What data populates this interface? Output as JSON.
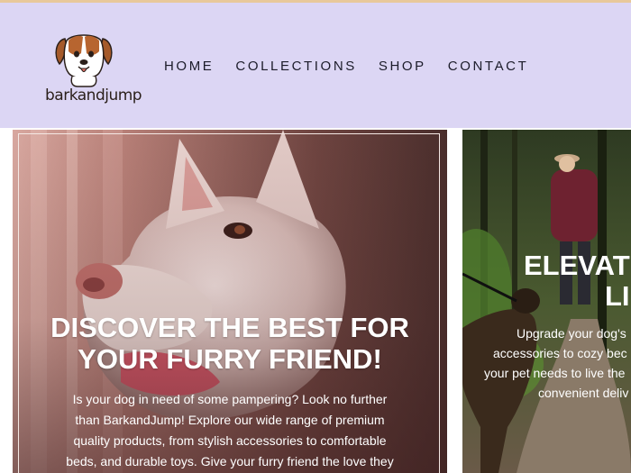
{
  "header": {
    "logo_text_bold": "bark",
    "logo_text_light": "andjump",
    "nav": [
      "HOME",
      "COLLECTIONS",
      "SHOP",
      "CONTACT"
    ]
  },
  "hero": {
    "heading_line1": "DISCOVER THE BEST FOR",
    "heading_line2": "YOUR FURRY FRIEND!",
    "body_lines": [
      "Is your dog in need of some pampering? Look no further",
      "than BarkandJump! Explore our wide range of premium",
      "quality products, from stylish accessories to comfortable",
      "beds, and durable toys. Give your furry friend the love they"
    ]
  },
  "slide2": {
    "heading_line1": "ELEVATI",
    "heading_line2": "LI",
    "body_lines": [
      "Upgrade your dog's",
      "accessories to cozy bec",
      "your pet needs to live the",
      "convenient deliv"
    ]
  },
  "colors": {
    "header_bg": "#dcd6f4",
    "nav_text": "#1c1c2a"
  }
}
